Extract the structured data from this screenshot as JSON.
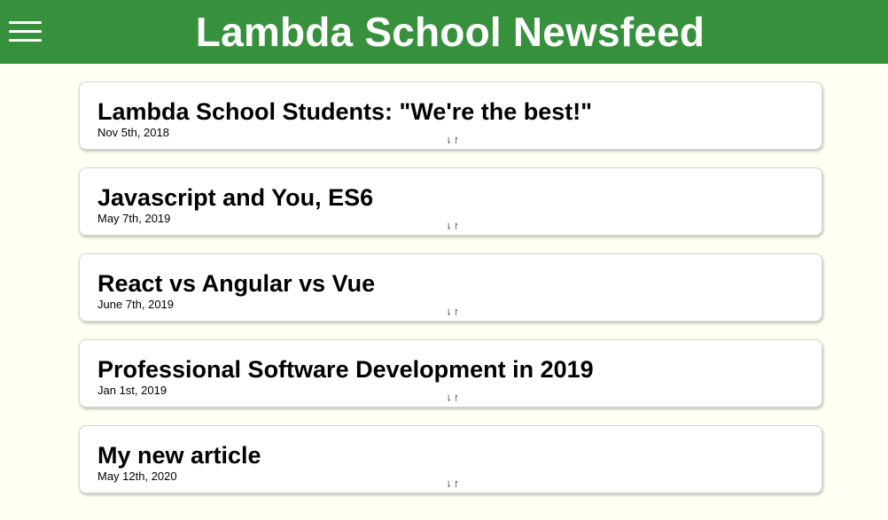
{
  "header": {
    "title": "Lambda School Newsfeed",
    "menu_icon": "hamburger-menu-icon",
    "background_color": "#37913c"
  },
  "articles": [
    {
      "title": "Lambda School Students: \"We're the best!\"",
      "date": "Nov 5th, 2018",
      "expand_glyph": "⇂↾"
    },
    {
      "title": "Javascript and You, ES6",
      "date": "May 7th, 2019",
      "expand_glyph": "⇂↾"
    },
    {
      "title": "React vs Angular vs Vue",
      "date": "June 7th, 2019",
      "expand_glyph": "⇂↾"
    },
    {
      "title": "Professional Software Development in 2019",
      "date": "Jan 1st, 2019",
      "expand_glyph": "⇂↾"
    },
    {
      "title": "My new article",
      "date": "May 12th, 2020",
      "expand_glyph": "⇂↾"
    }
  ],
  "colors": {
    "page_background": "#fffff3",
    "card_background": "#ffffff"
  }
}
